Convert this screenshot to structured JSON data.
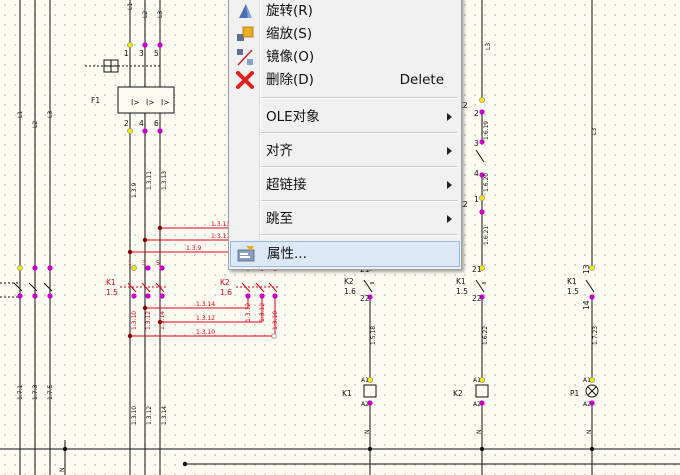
{
  "context_menu": {
    "items": [
      {
        "label": "旋转(R)",
        "icon": "rotate-icon"
      },
      {
        "label": "缩放(S)",
        "icon": "scale-icon"
      },
      {
        "label": "镜像(O)",
        "icon": "mirror-icon"
      },
      {
        "label": "删除(D)",
        "shortcut": "Delete",
        "icon": "delete-icon"
      },
      {
        "label": "OLE对象",
        "submenu": true
      },
      {
        "label": "对齐",
        "submenu": true
      },
      {
        "label": "超链接",
        "submenu": true
      },
      {
        "label": "跳至",
        "submenu": true
      },
      {
        "label": "属性...",
        "icon": "properties-icon",
        "highlighted": true
      }
    ]
  },
  "schematic": {
    "bus_labels": [
      "L1",
      "L2",
      "L3",
      "N"
    ],
    "left_cross_refs": [
      "1.7.1",
      "1.7.3",
      "1.7.5"
    ],
    "relay_f1": {
      "name": "F1",
      "top_terminals": [
        "1",
        "3",
        "5"
      ],
      "bottom_terminals": [
        "2",
        "4",
        "6"
      ],
      "pole_symbol": "I>"
    },
    "wire_refs_f1": [
      "1.3.9",
      "1.3.11",
      "1.3.13"
    ],
    "contactor_k1": {
      "name": "K1",
      "ref": "1.5",
      "terminals": [
        "1",
        "3",
        "5"
      ],
      "out_refs": [
        "1.3.10",
        "1.3.12",
        "1.3.14"
      ]
    },
    "contactor_k2": {
      "name": "K2",
      "ref": "1.6",
      "terminals": [
        "1",
        "3",
        "5"
      ],
      "out_refs": [
        "1.3.12",
        "1.3.12",
        "1.3.10"
      ]
    },
    "red_wire_refs": [
      "1.3.13",
      "1.3.11",
      "1.3.9",
      "1.3.14",
      "1.3.12",
      "1.3.10"
    ],
    "bottom_refs": [
      "1.3.10",
      "1.3.12",
      "1.3.14"
    ],
    "contact_k2_col1": {
      "name": "K2",
      "ref": "1.6",
      "t1": "21",
      "t2": "22",
      "wire": "1.5.18",
      "coil": "K1",
      "coil_a": "A1",
      "coil_b": "A2",
      "n": "N"
    },
    "contact_k1_col2": {
      "name": "K1",
      "ref": "1.5",
      "t1": "21",
      "t2": "22",
      "wire": "1.6.22",
      "coil": "K2",
      "coil_a": "A1",
      "coil_b": "A2",
      "n": "N"
    },
    "contact_k1_col3": {
      "name": "K1",
      "ref": "1.5",
      "t1": "13",
      "t2": "14",
      "wire": "1.7.23",
      "lamp": "P1",
      "lamp_a": "A1",
      "lamp_b": "A2",
      "n": "N"
    },
    "col2_upper": {
      "k": "K2",
      "refs": [
        "1.6.19",
        "1.6.20",
        "1.6.21"
      ],
      "terms": [
        "2",
        "3",
        "4",
        "1"
      ]
    },
    "colors": {
      "red": "#e0001b",
      "magenta": "#cc00cc",
      "yellow": "#f5e800"
    }
  }
}
